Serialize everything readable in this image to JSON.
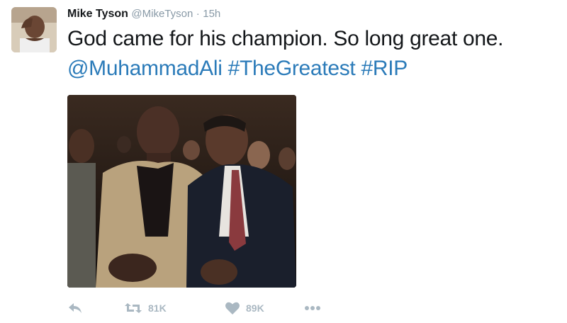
{
  "tweet": {
    "author_name": "Mike Tyson",
    "handle": "@MikeTyson",
    "separator": "·",
    "time": "15h",
    "text_plain": "God came for his champion. So long great one.",
    "mention": "@MuhammadAli",
    "hashtags": [
      "#TheGreatest",
      "#RIP"
    ]
  },
  "actions": {
    "retweet_count": "81K",
    "like_count": "89K"
  },
  "icons": {
    "reply": "reply-icon",
    "retweet": "retweet-icon",
    "like": "heart-icon",
    "more": "more-icon"
  },
  "colors": {
    "link": "#2b7bb9",
    "muted": "#8899a6",
    "action": "#aab8c2",
    "text": "#14171a"
  }
}
